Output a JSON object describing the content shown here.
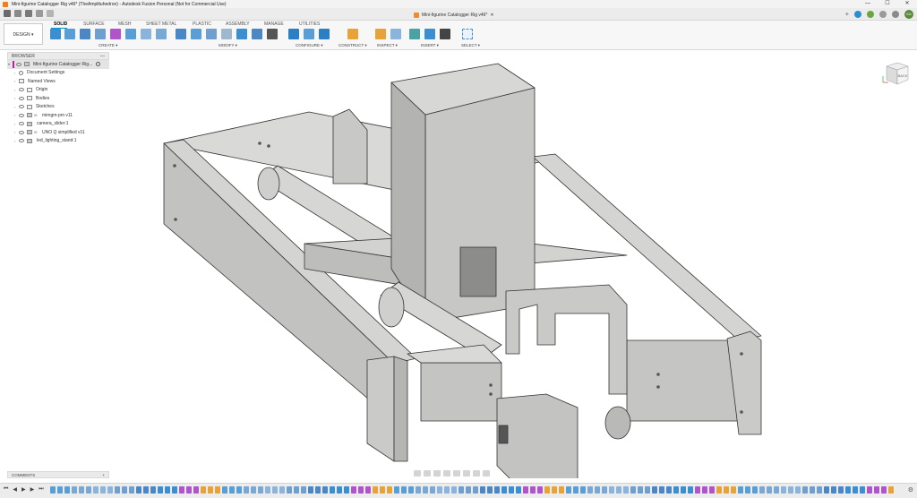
{
  "window": {
    "title": "Mini-figurine Catalogger Rig v46* (TheAmplituhedron) - Autodesk Fusion Personal (Not for Commercial Use)",
    "controls": [
      "—",
      "☐",
      "✕"
    ]
  },
  "doc_tab": {
    "label": "Mini-figurine Catalogger Rig v46*",
    "close": "✕"
  },
  "user_avatar": "KA",
  "workspace": {
    "label": "DESIGN",
    "dropdown": "▾"
  },
  "ribbon_tabs": [
    "SOLID",
    "SURFACE",
    "MESH",
    "SHEET METAL",
    "PLASTIC",
    "ASSEMBLY",
    "MANAGE",
    "UTILITIES"
  ],
  "ribbon_groups": [
    "CREATE ▾",
    "MODIFY ▾",
    "CONFIGURE ▾",
    "CONSTRUCT ▾",
    "INSPECT ▾",
    "INSERT ▾",
    "SELECT ▾"
  ],
  "browser": {
    "title": "BROWSER",
    "root": "Mini-figurine Catalogger Rig...",
    "items": [
      {
        "label": "Document Settings",
        "kind": "gear"
      },
      {
        "label": "Named Views",
        "kind": "folder"
      },
      {
        "label": "Origin",
        "kind": "folder"
      },
      {
        "label": "Bodies",
        "kind": "folder"
      },
      {
        "label": "Sketches",
        "kind": "folder"
      },
      {
        "label": "mimgm-pm v11",
        "kind": "link"
      },
      {
        "label": "camera_slider:1",
        "kind": "component"
      },
      {
        "label": "UNO Q simplified v11",
        "kind": "link"
      },
      {
        "label": "led_lighting_stand:1",
        "kind": "component"
      }
    ]
  },
  "comments": {
    "label": "COMMENTS",
    "add": "+"
  },
  "viewcube": {
    "face": "BACK"
  },
  "timeline": {
    "controls": [
      "⏮",
      "◀",
      "▶",
      "▶",
      "⏭"
    ],
    "settings": "⚙"
  },
  "colors": {
    "accent": "#0696d7",
    "model_light": "#d8d8d6",
    "model_mid": "#c4c4c2",
    "model_dark": "#a9a9a7",
    "edge": "#333333"
  }
}
